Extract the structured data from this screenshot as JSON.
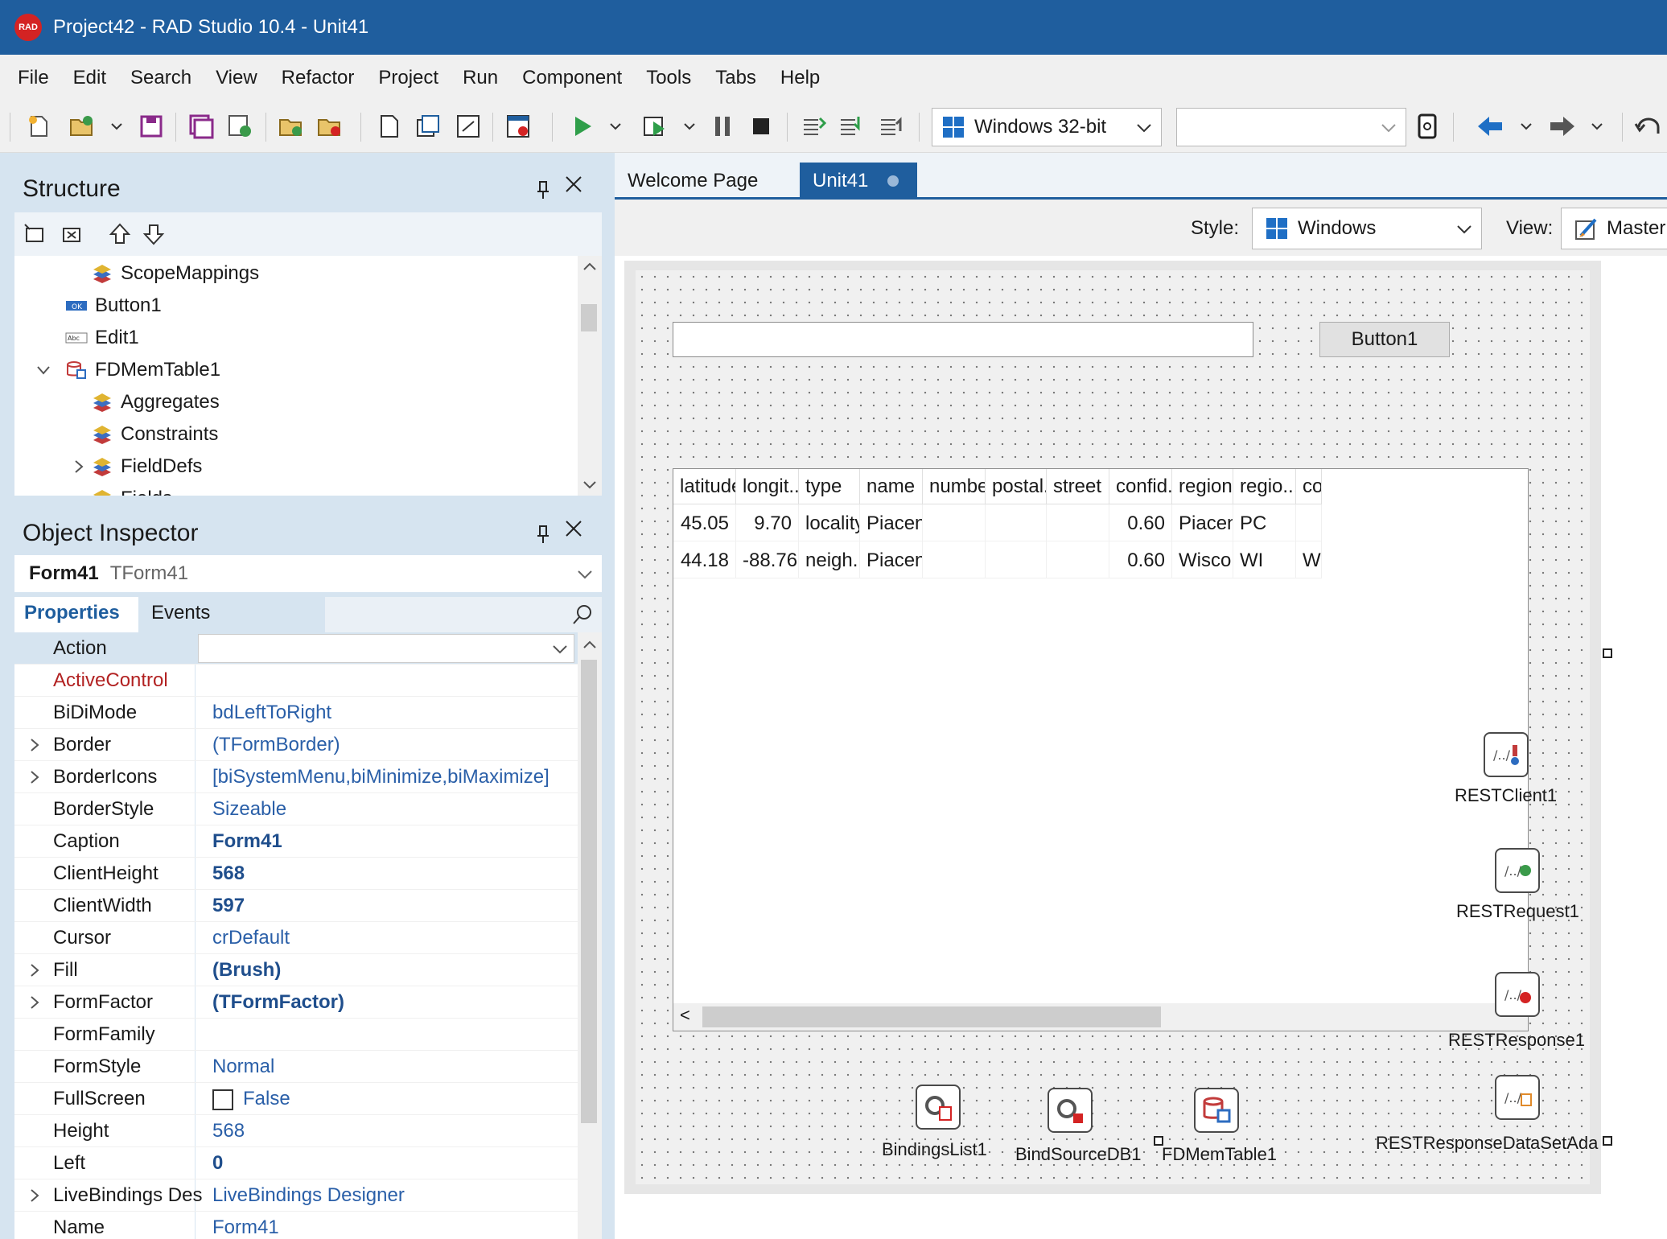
{
  "window": {
    "title": "Project42 - RAD Studio 10.4 - Unit41",
    "logo_text": "RAD"
  },
  "menu": [
    "File",
    "Edit",
    "Search",
    "View",
    "Refactor",
    "Project",
    "Run",
    "Component",
    "Tools",
    "Tabs",
    "Help"
  ],
  "toolbar": {
    "platform": "Windows 32-bit",
    "config": ""
  },
  "structure": {
    "title": "Structure",
    "items": [
      {
        "label": "ScopeMappings"
      },
      {
        "label": "Button1"
      },
      {
        "label": "Edit1"
      },
      {
        "label": "FDMemTable1"
      },
      {
        "label": "Aggregates"
      },
      {
        "label": "Constraints"
      },
      {
        "label": "FieldDefs"
      },
      {
        "label": "Fields"
      }
    ]
  },
  "inspector": {
    "title": "Object Inspector",
    "object_name": "Form41",
    "object_type": "TForm41",
    "tabs": {
      "properties": "Properties",
      "events": "Events"
    },
    "rows": [
      {
        "name": "Action",
        "value": ""
      },
      {
        "name": "ActiveControl",
        "value": ""
      },
      {
        "name": "BiDiMode",
        "value": "bdLeftToRight"
      },
      {
        "name": "Border",
        "value": "(TFormBorder)"
      },
      {
        "name": "BorderIcons",
        "value": "[biSystemMenu,biMinimize,biMaximize]"
      },
      {
        "name": "BorderStyle",
        "value": "Sizeable"
      },
      {
        "name": "Caption",
        "value": "Form41"
      },
      {
        "name": "ClientHeight",
        "value": "568"
      },
      {
        "name": "ClientWidth",
        "value": "597"
      },
      {
        "name": "Cursor",
        "value": "crDefault"
      },
      {
        "name": "Fill",
        "value": "(Brush)"
      },
      {
        "name": "FormFactor",
        "value": "(TFormFactor)"
      },
      {
        "name": "FormFamily",
        "value": ""
      },
      {
        "name": "FormStyle",
        "value": "Normal"
      },
      {
        "name": "FullScreen",
        "value": "False"
      },
      {
        "name": "Height",
        "value": "568"
      },
      {
        "name": "Left",
        "value": "0"
      },
      {
        "name": "LiveBindings Des",
        "value": "LiveBindings Designer"
      },
      {
        "name": "Name",
        "value": "Form41"
      }
    ]
  },
  "editor": {
    "tabs": [
      "Welcome Page",
      "Unit41"
    ],
    "style_label": "Style:",
    "style_value": "Windows",
    "view_label": "View:",
    "view_value": "Master"
  },
  "form": {
    "button_label": "Button1",
    "grid": {
      "columns": [
        "latitude",
        "longit...",
        "type",
        "name",
        "number",
        "postal...",
        "street",
        "confid...",
        "region",
        "regio...",
        "co"
      ],
      "rows": [
        [
          "45.05",
          "9.70",
          "locality",
          "Piacen...",
          "",
          "",
          "",
          "0.60",
          "Piacen...",
          "PC",
          ""
        ],
        [
          "44.18",
          "-88.76",
          "neigh...",
          "Piacen...",
          "",
          "",
          "",
          "0.60",
          "Wisco...",
          "WI",
          "Wi"
        ]
      ],
      "scroll_left": "<"
    },
    "components": [
      {
        "label": "RESTClient1"
      },
      {
        "label": "RESTRequest1"
      },
      {
        "label": "RESTResponse1"
      },
      {
        "label": "RESTResponseDataSetAda"
      },
      {
        "label": "BindingsList1"
      },
      {
        "label": "BindSourceDB1"
      },
      {
        "label": "FDMemTable1"
      }
    ]
  },
  "colors": {
    "titlebar": "#1f5e9e",
    "panel": "#d6e4f0",
    "value_text": "#2a5fa8",
    "active_control": "#b22222"
  }
}
